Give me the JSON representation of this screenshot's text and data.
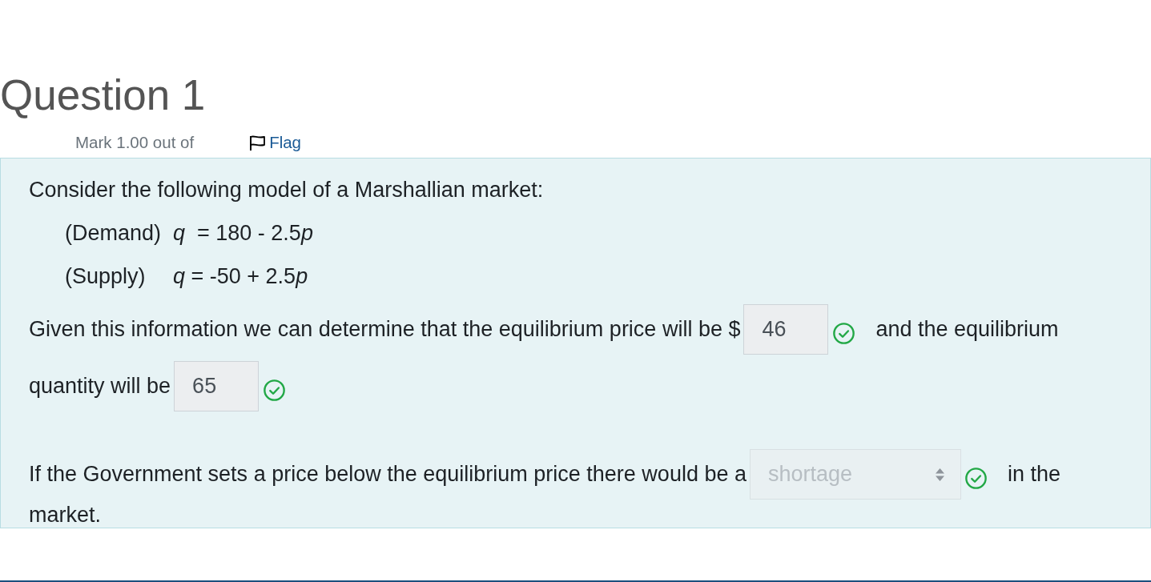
{
  "question": {
    "title": "Question 1",
    "mark": "Mark 1.00 out of",
    "flag": {
      "label": "Flag",
      "flagged": false
    }
  },
  "panel": {
    "intro": "Consider the following model of a Marshallian market:",
    "equations": [
      {
        "label": "(Demand)",
        "formula": [
          {
            "text": "q",
            "italic": true
          },
          {
            "text": "  = 180 - 2.5",
            "italic": false
          },
          {
            "text": "p",
            "italic": true
          }
        ]
      },
      {
        "label": "(Supply)",
        "formula": [
          {
            "text": "q",
            "italic": true
          },
          {
            "text": " = -50 + 2.5",
            "italic": false
          },
          {
            "text": "p",
            "italic": true
          }
        ]
      }
    ],
    "paragraphs": [
      {
        "segments": [
          {
            "kind": "text",
            "text": "Given this information we can determine that the equilibrium price will be $"
          },
          {
            "kind": "input",
            "value": "46",
            "disabled": true,
            "correct": true
          },
          {
            "kind": "text",
            "text": "and the equilibrium"
          },
          {
            "kind": "text",
            "text": "quantity will be"
          },
          {
            "kind": "input",
            "value": "65",
            "disabled": true,
            "correct": true
          }
        ]
      },
      {
        "segments": [
          {
            "kind": "text",
            "text": "If the Government sets a price below the equilibrium price there would be a"
          },
          {
            "kind": "select",
            "value": "shortage",
            "disabled": true,
            "correct": true
          },
          {
            "kind": "text",
            "text": "in the"
          },
          {
            "kind": "text",
            "text": "market."
          }
        ]
      }
    ]
  }
}
